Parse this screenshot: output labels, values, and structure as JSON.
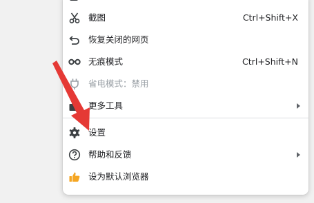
{
  "menu": {
    "items": [
      {
        "label": "截图",
        "shortcut": "Ctrl+Shift+X",
        "icon": "scissors-icon"
      },
      {
        "label": "恢复关闭的网页",
        "shortcut": "",
        "icon": "undo-icon"
      },
      {
        "label": "无痕模式",
        "shortcut": "Ctrl+Shift+N",
        "icon": "incognito-icon"
      },
      {
        "label": "省电模式：禁用",
        "shortcut": "",
        "icon": "plug-icon",
        "disabled": true
      },
      {
        "label": "更多工具",
        "shortcut": "",
        "icon": "toolbox-icon",
        "submenu": true
      },
      {
        "label": "设置",
        "shortcut": "",
        "icon": "gear-icon"
      },
      {
        "label": "帮助和反馈",
        "shortcut": "",
        "icon": "help-icon",
        "submenu": true
      },
      {
        "label": "设为默认浏览器",
        "shortcut": "",
        "icon": "thumbs-up-icon"
      }
    ]
  },
  "colors": {
    "menu_bg": "#ffffff",
    "text": "#202124",
    "disabled_text": "#9aa0a6",
    "icon": "#3c4043",
    "annotation_arrow": "#e53935",
    "thumbs_up": "#f5a623"
  }
}
